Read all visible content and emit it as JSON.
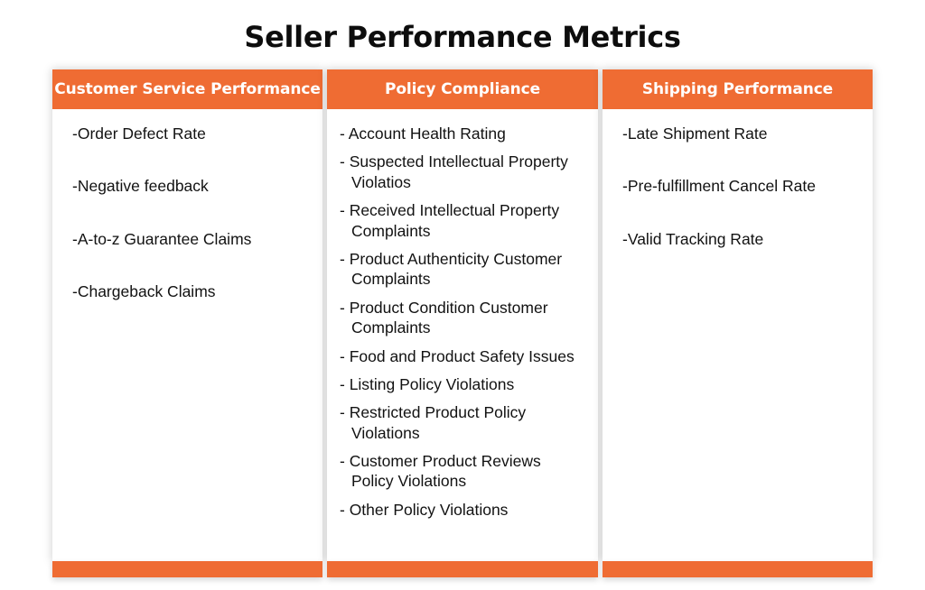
{
  "page": {
    "title": "Seller Performance Metrics"
  },
  "theme": {
    "accent_orange": "#EF6C33",
    "header_text": "#FFFFFF",
    "body_text": "#121212",
    "page_background": "#FFFFFF"
  },
  "columns": [
    {
      "header": "Customer Service Performance",
      "items": [
        "-Order Defect Rate",
        "-Negative feedback",
        "-A-to-z Guarantee Claims",
        "-Chargeback Claims"
      ]
    },
    {
      "header": "Policy Compliance",
      "items": [
        "- Account Health Rating",
        "- Suspected Intellectual Property Violatios",
        "- Received Intellectual Property Complaints",
        "- Product Authenticity Customer Complaints",
        "- Product Condition Customer Complaints",
        "- Food and Product Safety Issues",
        "- Listing Policy Violations",
        "- Restricted Product Policy Violations",
        "- Customer Product Reviews Policy Violations",
        "- Other Policy Violations"
      ]
    },
    {
      "header": "Shipping Performance",
      "items": [
        "-Late Shipment Rate",
        "-Pre-fulfillment Cancel Rate",
        "-Valid Tracking Rate"
      ]
    }
  ]
}
